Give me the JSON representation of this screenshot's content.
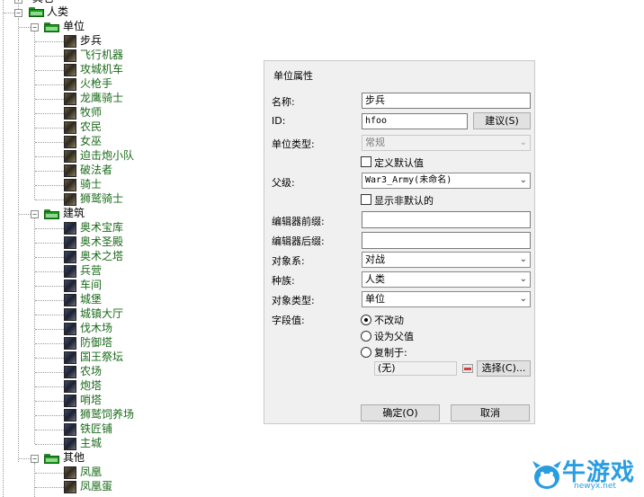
{
  "tree": {
    "prev_category_label": "其它",
    "category_label": "人类",
    "groups": [
      {
        "label": "单位",
        "items": [
          "步兵",
          "飞行机器",
          "攻城机车",
          "火枪手",
          "龙鹰骑士",
          "牧师",
          "农民",
          "女巫",
          "迫击炮小队",
          "破法者",
          "骑士",
          "狮鹫骑士"
        ]
      },
      {
        "label": "建筑",
        "items": [
          "奥术宝库",
          "奥术圣殿",
          "奥术之塔",
          "兵营",
          "车间",
          "城堡",
          "城镇大厅",
          "伐木场",
          "防御塔",
          "国王祭坛",
          "农场",
          "炮塔",
          "哨塔",
          "狮鹫饲养场",
          "铁匠铺",
          "主城"
        ]
      },
      {
        "label": "其他",
        "items": [
          "凤凰",
          "凤凰蛋"
        ]
      }
    ],
    "selected_item": "步兵"
  },
  "dialog": {
    "title": "单位属性",
    "name_label": "名称:",
    "name_value": "步兵",
    "id_label": "ID:",
    "id_value": "hfoo",
    "suggest_button": "建议(S)",
    "unit_type_label": "单位类型:",
    "unit_type_value": "常规",
    "custom_default_label": "定义默认值",
    "parent_label": "父级:",
    "parent_value": "War3_Army(未命名)",
    "show_nondefault_label": "显示非默认的",
    "editor_prefix_label": "编辑器前缀:",
    "editor_prefix_value": "",
    "editor_suffix_label": "编辑器后缀:",
    "editor_suffix_value": "",
    "object_system_label": "对象系:",
    "object_system_value": "对战",
    "race_label": "种族:",
    "race_value": "人类",
    "object_type_label": "对象类型:",
    "object_type_value": "单位",
    "field_value_label": "字段值:",
    "radio_options": [
      "不改动",
      "设为父值",
      "复制于:"
    ],
    "radio_selected": 0,
    "copy_from_value": "(无)",
    "choose_button": "选择(C)...",
    "ok_button": "确定(O)",
    "cancel_button": "取消"
  },
  "watermark": {
    "text": "牛游戏",
    "sub": "newyx.net"
  },
  "colors": {
    "item_text": "#1a6a1a",
    "folder_green": "#1c9a1c",
    "dialog_bg": "#f0f0f0",
    "watermark_blue": "#2a9de0"
  }
}
